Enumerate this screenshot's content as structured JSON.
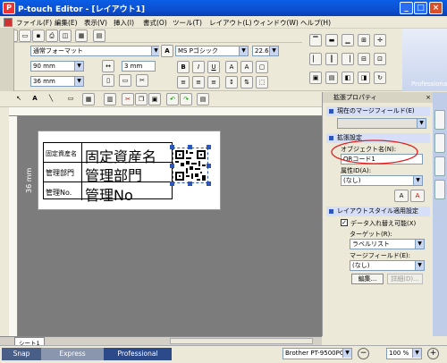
{
  "app": {
    "title": "P-touch Editor - [レイアウト1]"
  },
  "menu": [
    "ファイル(F)",
    "編集(E)",
    "表示(V)",
    "挿入(I)",
    "書式(O)",
    "ツール(T)",
    "レイアウト(L)",
    "ウィンドウ(W)",
    "ヘルプ(H)"
  ],
  "toolbar": {
    "format": "通常フォーマット",
    "width": "90 mm",
    "height": "36 mm",
    "margin": "3 mm",
    "font": "MS Pゴシック",
    "font_size": "22.6",
    "professional": "Professional"
  },
  "ruler": {
    "side_label": "36 mm"
  },
  "label": {
    "rows": [
      {
        "left": "固定資産名",
        "right": "固定資産名"
      },
      {
        "left": "管理部門",
        "right": "管理部門"
      },
      {
        "left": "管理No.",
        "right": "管理No"
      }
    ]
  },
  "sheet_tab": "シート1",
  "panel": {
    "header": "拡張プロパティ",
    "current_merge_field": "現在のマージフィールド(E)",
    "ext_settings": "拡張設定",
    "object_name_label": "オブジェクト名(N):",
    "object_name": "QRコード1",
    "attribute_label": "属性ID(A):",
    "attribute_value": "(なし)",
    "layout_style": "レイアウトスタイル適用設定",
    "data_replace": "データ入れ替え可能(X)",
    "target_label": "ターゲット(R):",
    "target_value": "ラベルリスト",
    "merge_field_label": "マージフィールド(E):",
    "merge_field_value": "(なし)",
    "edit_button": "編集...",
    "detail_button": "詳細(D)..."
  },
  "status": {
    "snap": "Snap",
    "express": "Express",
    "professional": "Professional",
    "printer": "Brother PT-9500PC",
    "zoom": "100 %"
  }
}
